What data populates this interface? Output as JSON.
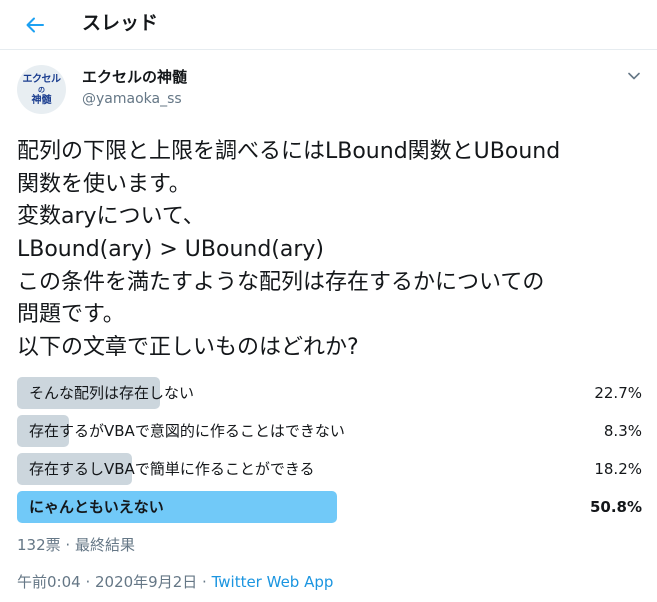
{
  "header": {
    "back_icon": "arrow-left-icon",
    "title": "スレッド",
    "accent_color": "#1da1f2"
  },
  "author": {
    "avatar_lines": [
      "エクセル",
      "の",
      "神髄"
    ],
    "display_name": "エクセルの神髄",
    "handle": "@yamaoka_ss",
    "menu_icon": "chevron-down-icon"
  },
  "tweet": {
    "lines": [
      "配列の下限と上限を調べるにはLBound関数とUBound",
      "関数を使います。",
      "変数aryについて、",
      "LBound(ary) > UBound(ary)",
      "この条件を満たすような配列は存在するかについての",
      "問題です。",
      "以下の文章で正しいものはどれか?"
    ]
  },
  "poll": {
    "options": [
      {
        "label": "そんな配列は存在しない",
        "percent": "22.7%",
        "value": 22.7,
        "winner": false
      },
      {
        "label": "存在するがVBAで意図的に作ることはできない",
        "percent": "8.3%",
        "value": 8.3,
        "winner": false
      },
      {
        "label": "存在するしVBAで簡単に作ることができる",
        "percent": "18.2%",
        "value": 18.2,
        "winner": false
      },
      {
        "label": "にゃんともいえない",
        "percent": "50.8%",
        "value": 50.8,
        "winner": true
      }
    ],
    "votes": "132票",
    "separator": " · ",
    "status": "最終結果",
    "bar_color": "#ccd6dd",
    "winner_color": "#71c9f8"
  },
  "meta": {
    "time": "午前0:04",
    "separator1": " · ",
    "date": "2020年9月2日",
    "separator2": " · ",
    "app": "Twitter Web App"
  }
}
